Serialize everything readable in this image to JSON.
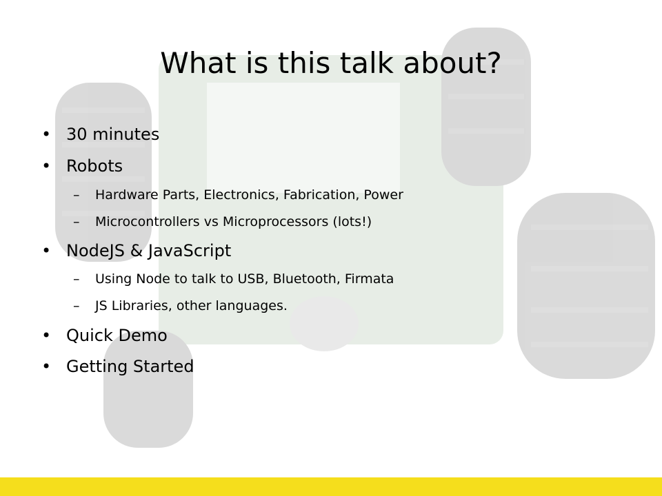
{
  "slide": {
    "title": "What is this talk about?",
    "bullets": [
      {
        "text": "30 minutes"
      },
      {
        "text": "Robots",
        "sub": [
          "Hardware Parts, Electronics, Fabrication, Power",
          "Microcontrollers vs Microprocessors (lots!)"
        ]
      },
      {
        "text": "NodeJS & JavaScript",
        "sub": [
          "Using Node to talk to USB, Bluetooth, Firmata",
          "JS Libraries, other languages."
        ]
      },
      {
        "text": "Quick Demo"
      },
      {
        "text": "Getting Started"
      }
    ],
    "bullet_glyph": "•",
    "sub_glyph": "–"
  },
  "colors": {
    "footer_bar": "#f5de1c",
    "background_tint": "#e9efe6"
  }
}
